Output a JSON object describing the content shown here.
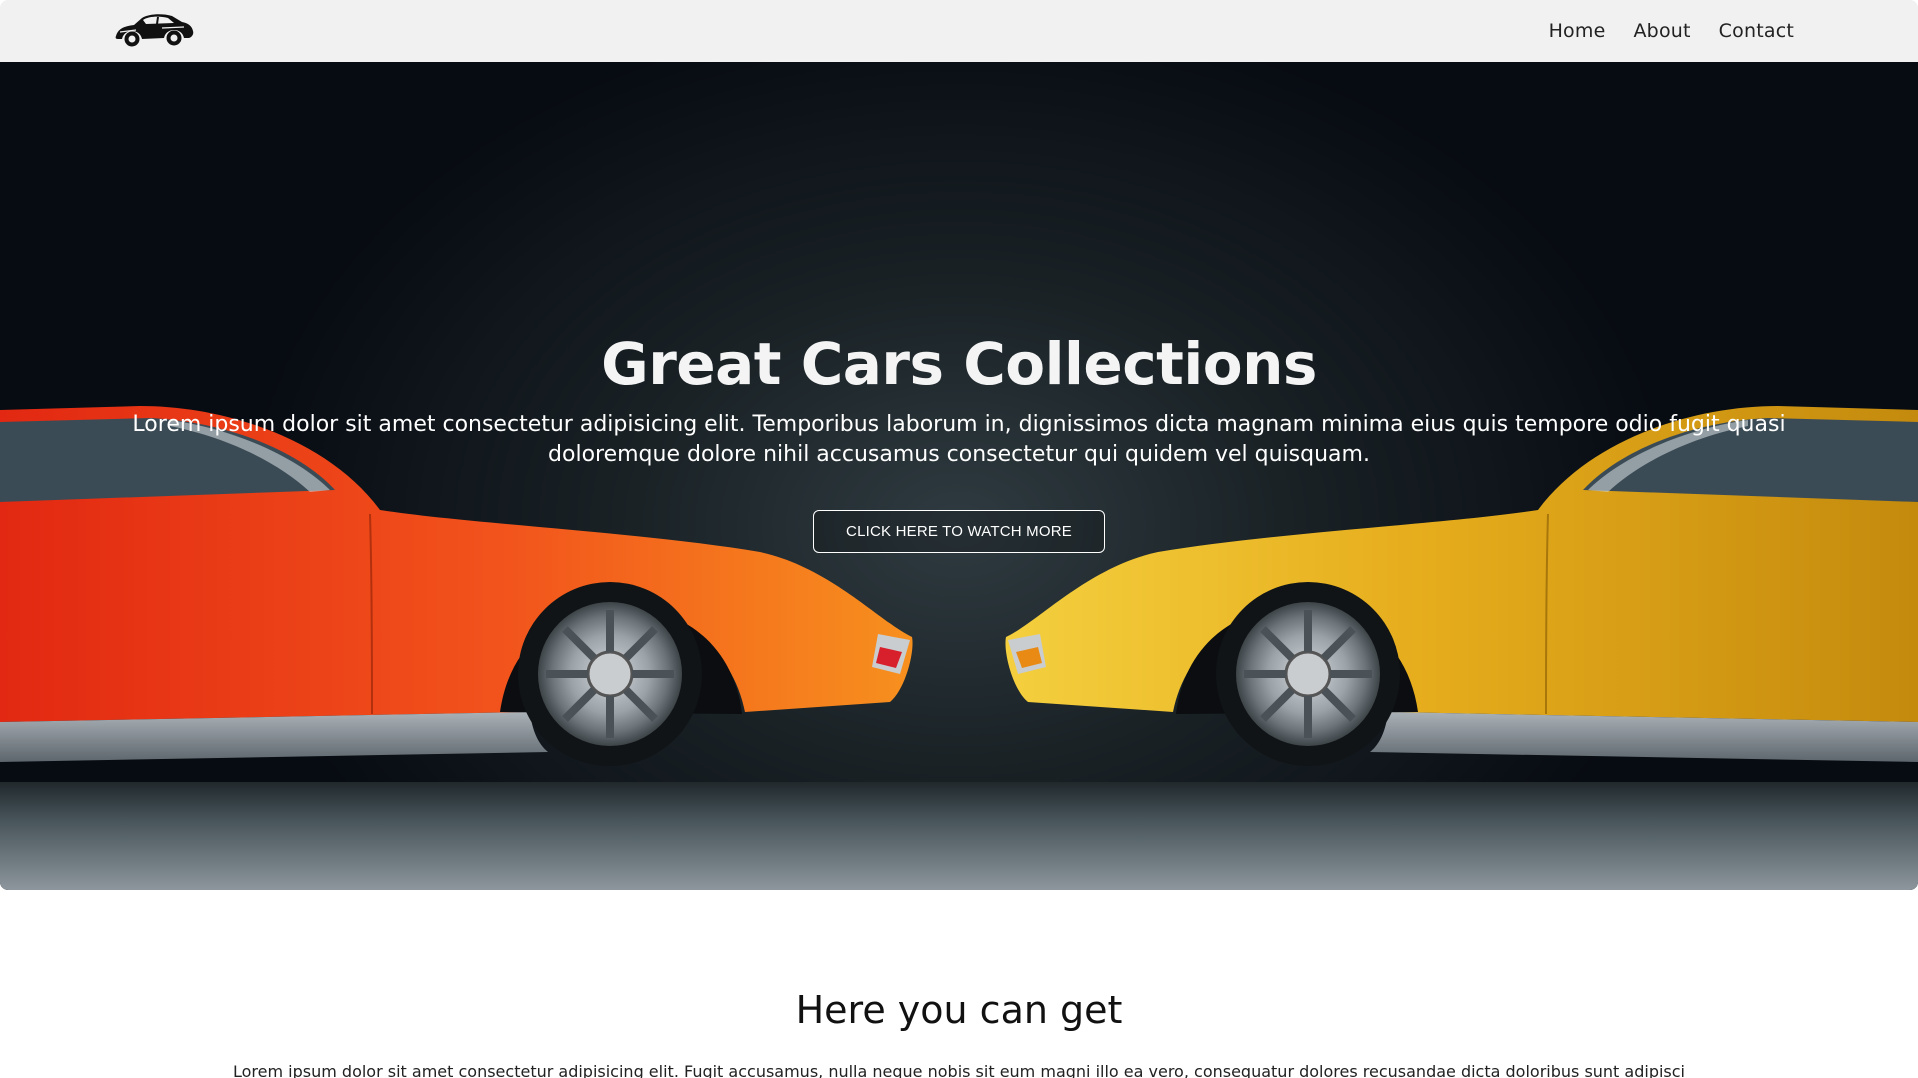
{
  "navbar": {
    "logo_icon": "car-logo-icon",
    "links": [
      {
        "label": "Home"
      },
      {
        "label": "About"
      },
      {
        "label": "Contact"
      }
    ]
  },
  "hero": {
    "title": "Great Cars Collections",
    "text": "Lorem ipsum dolor sit amet consectetur adipisicing elit. Temporibus laborum in, dignissimos dicta magnam minima eius quis tempore odio fugit quasi doloremque dolore nihil accusamus consectetur qui quidem vel quisquam.",
    "button_label": "CLICK HERE TO WATCH MORE",
    "left_car_color": "#e8501a",
    "right_car_color": "#e9b21f"
  },
  "section": {
    "title": "Here you can get",
    "text": "Lorem ipsum dolor sit amet consectetur adipisicing elit. Fugit accusamus, nulla neque nobis sit eum magni illo ea vero, consequatur dolores recusandae dicta doloribus sunt adipisci"
  }
}
